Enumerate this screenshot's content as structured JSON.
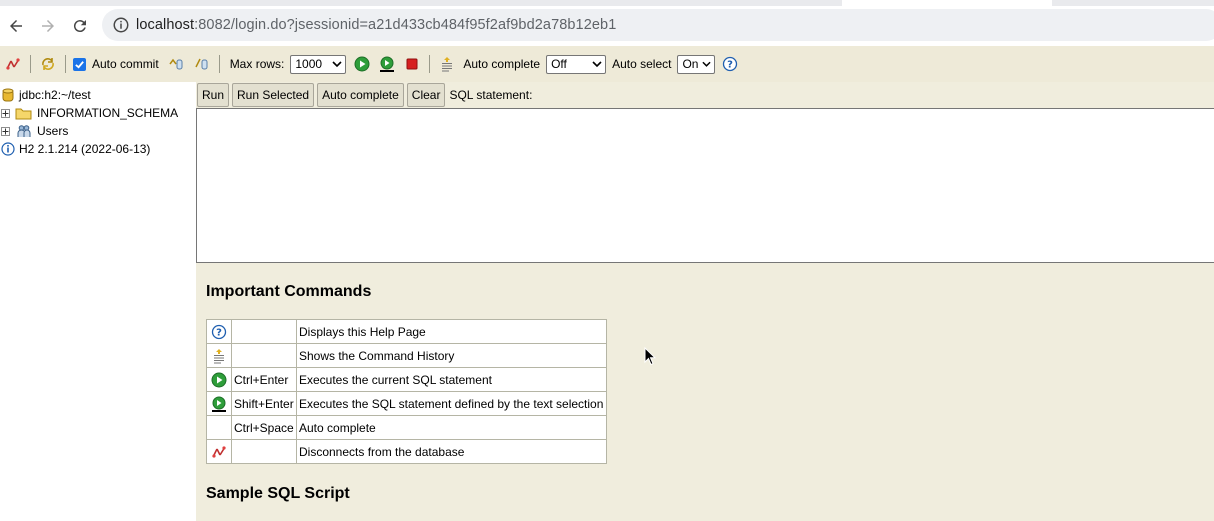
{
  "browser": {
    "url_host": "localhost",
    "url_rest": ":8082/login.do?jsessionid=a21d433cb484f95f2af9bd2a78b12eb1"
  },
  "toolbar": {
    "auto_commit_label": "Auto commit",
    "auto_commit_checked": true,
    "max_rows_label": "Max rows:",
    "max_rows_value": "1000",
    "auto_complete_label": "Auto complete",
    "auto_complete_value": "Off",
    "auto_select_label": "Auto select",
    "auto_select_value": "On"
  },
  "tree": {
    "connection": "jdbc:h2:~/test",
    "items": [
      {
        "label": "INFORMATION_SCHEMA",
        "icon": "folder-icon"
      },
      {
        "label": "Users",
        "icon": "users-icon"
      }
    ],
    "version": "H2 2.1.214 (2022-06-13)"
  },
  "query": {
    "buttons": {
      "run": "Run",
      "run_selected": "Run Selected",
      "auto_complete": "Auto complete",
      "clear": "Clear"
    },
    "sql_label": "SQL statement:",
    "sql_text": ""
  },
  "help": {
    "important_title": "Important Commands",
    "commands": [
      {
        "icon": "help-icon",
        "key": "",
        "desc": "Displays this Help Page"
      },
      {
        "icon": "history-icon",
        "key": "",
        "desc": "Shows the Command History"
      },
      {
        "icon": "run-icon",
        "key": "Ctrl+Enter",
        "desc": "Executes the current SQL statement"
      },
      {
        "icon": "run-selected-icon",
        "key": "Shift+Enter",
        "desc": "Executes the SQL statement defined by the text selection"
      },
      {
        "icon": "",
        "key": "Ctrl+Space",
        "desc": "Auto complete"
      },
      {
        "icon": "disconnect-icon",
        "key": "",
        "desc": "Disconnects from the database"
      }
    ],
    "sample_title": "Sample SQL Script"
  },
  "colors": {
    "toolbar_bg": "#eeead8",
    "query_bg": "#f0eddd",
    "run_green": "#2e9e3a",
    "stop_red": "#d62020",
    "help_blue": "#1f5fb0"
  }
}
